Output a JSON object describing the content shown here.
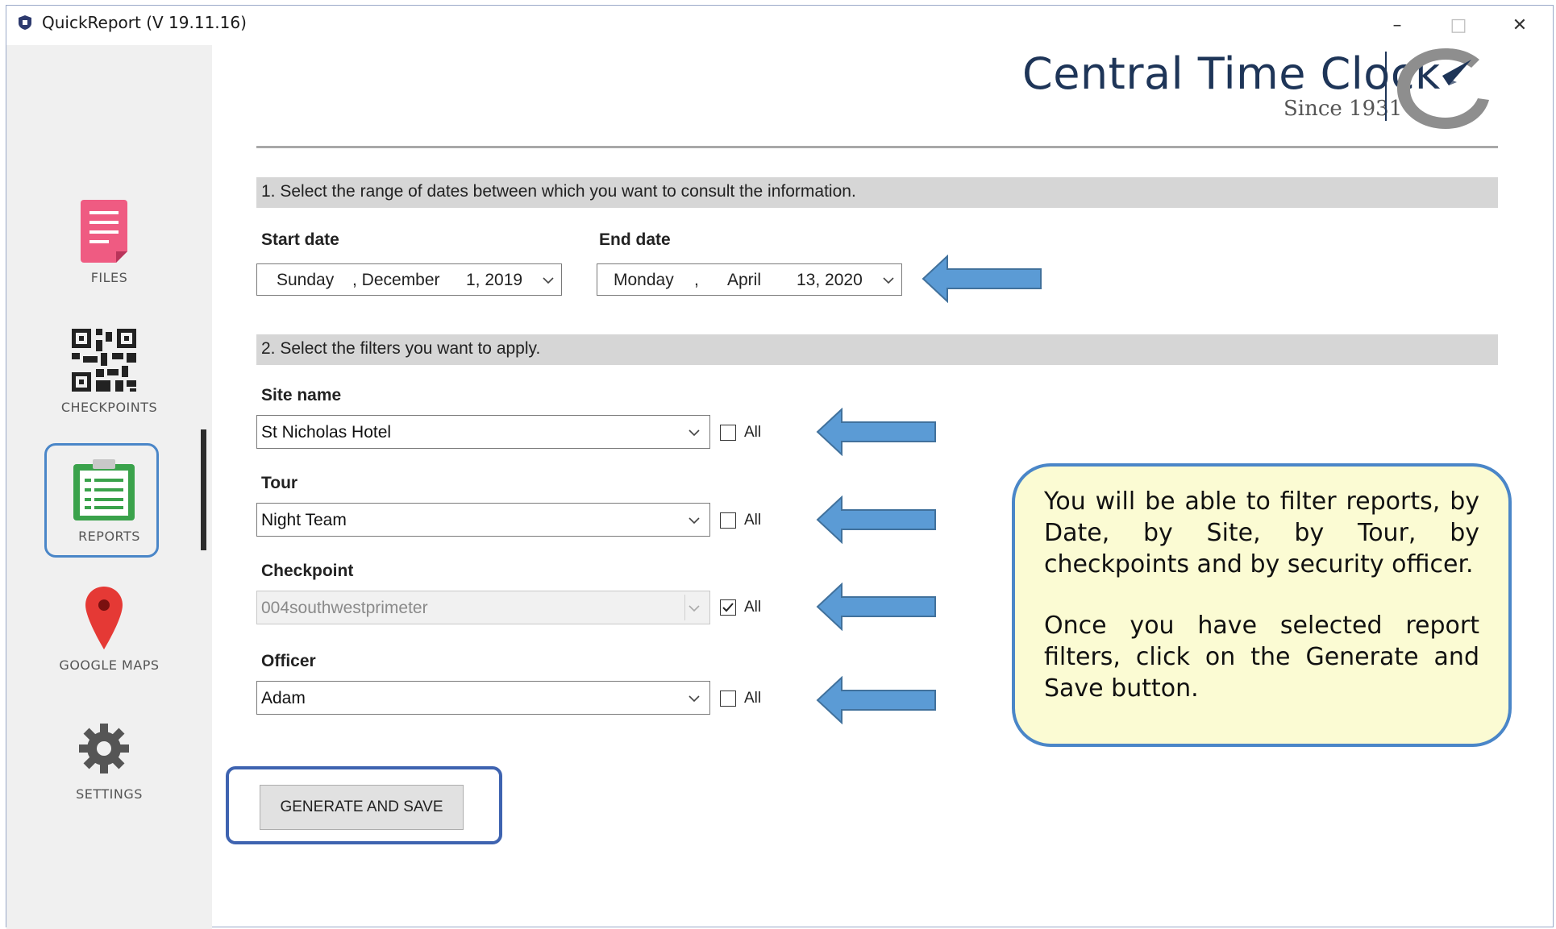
{
  "window": {
    "title": "QuickReport (V 19.11.16)",
    "controls": {
      "minimize": "–",
      "maximize": "□",
      "close": "✕"
    }
  },
  "sidebar": {
    "items": [
      {
        "label": "FILES",
        "icon": "files-icon"
      },
      {
        "label": "CHECKPOINTS",
        "icon": "qr-code-icon"
      },
      {
        "label": "REPORTS",
        "icon": "clipboard-icon",
        "active": true
      },
      {
        "label": "GOOGLE MAPS",
        "icon": "map-pin-icon"
      },
      {
        "label": "SETTINGS",
        "icon": "gear-icon"
      }
    ]
  },
  "logo": {
    "name": "Central Time Clock",
    "since": "Since 1931"
  },
  "section1": {
    "heading": "1. Select the range of dates between which you want to consult the information.",
    "start": {
      "label": "Start date",
      "weekday": "Sunday",
      "month": ", December",
      "day_year": "1, 2019"
    },
    "end": {
      "label": "End date",
      "weekday": "Monday",
      "comma": ",",
      "month": "April",
      "day_year": "13, 2020"
    }
  },
  "section2": {
    "heading": "2. Select the filters you want to apply.",
    "filters": [
      {
        "label": "Site name",
        "value": "St Nicholas Hotel",
        "all_label": "All",
        "all_checked": false,
        "disabled": false
      },
      {
        "label": "Tour",
        "value": "Night Team",
        "all_label": "All",
        "all_checked": false,
        "disabled": false
      },
      {
        "label": "Checkpoint",
        "value": "004southwestprimeter",
        "all_label": "All",
        "all_checked": true,
        "disabled": true
      },
      {
        "label": "Officer",
        "value": "Adam",
        "all_label": "All",
        "all_checked": false,
        "disabled": false
      }
    ]
  },
  "generate_button": "GENERATE AND SAVE",
  "callout": {
    "p1": "You will be able to filter  reports, by Date, by Site, by Tour, by checkpoints and by security officer.",
    "p2": "Once you have selected report filters, click on the Generate and Save button."
  },
  "colors": {
    "accent": "#4a86c8",
    "callout_bg": "#fbfbd3",
    "arrow": "#5b9bd5",
    "logo": "#1e3558"
  }
}
